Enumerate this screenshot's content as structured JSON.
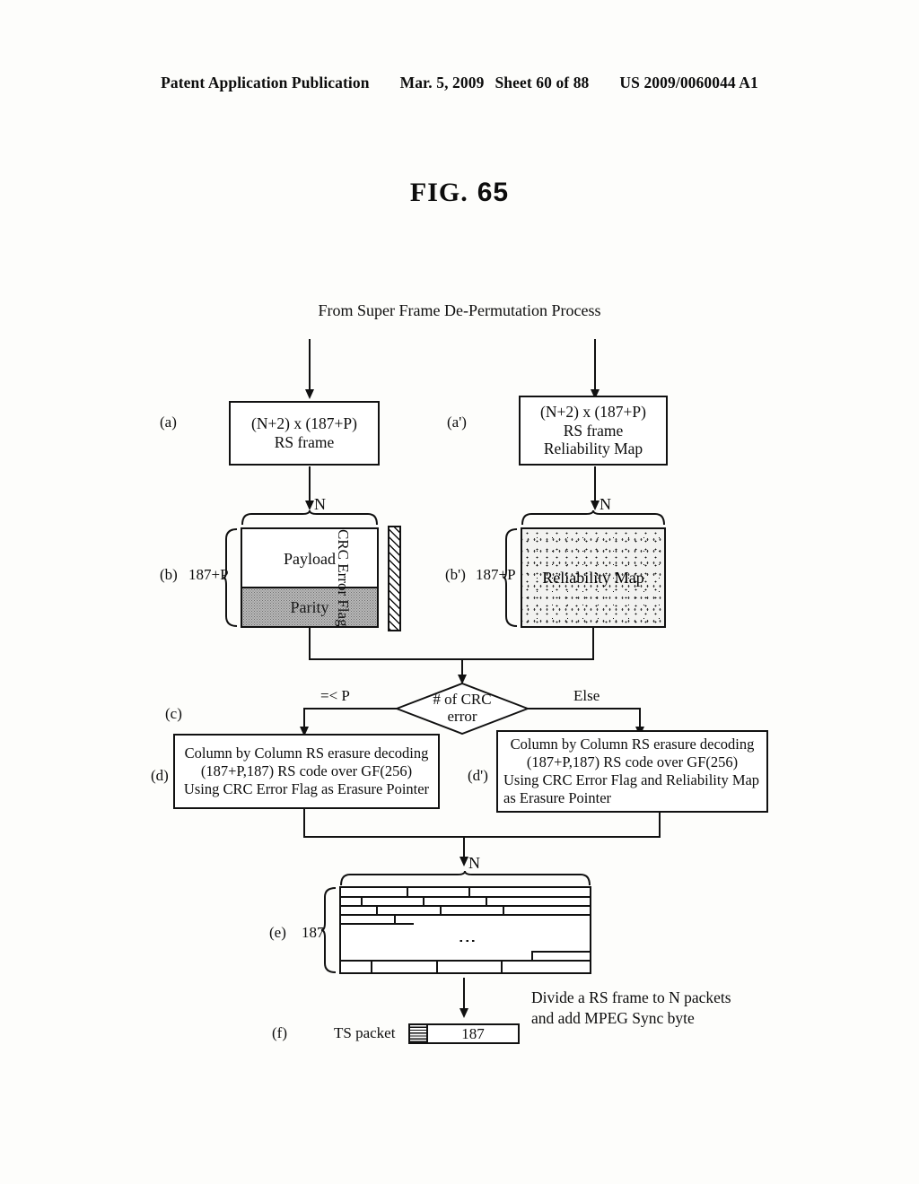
{
  "header": {
    "publication": "Patent Application Publication",
    "date": "Mar. 5, 2009",
    "sheet": "Sheet 60 of 88",
    "docnum": "US 2009/0060044 A1"
  },
  "figure": {
    "label": "FIG.",
    "number": "65"
  },
  "diagram": {
    "source_text": "From Super Frame De-Permutation Process",
    "steps": {
      "a": {
        "tag": "(a)",
        "line1": "(N+2) x (187+P)",
        "line2": "RS frame"
      },
      "a_prime": {
        "tag": "(a')",
        "line1": "(N+2) x (187+P)",
        "line2": "RS frame",
        "line3": "Reliability Map"
      },
      "b": {
        "tag": "(b)",
        "row_label": "187+P",
        "top_label": "N",
        "payload": "Payload",
        "parity": "Parity",
        "crc_flag": "CRC Error Flag"
      },
      "b_prime": {
        "tag": "(b')",
        "row_label": "187+P",
        "top_label": "N",
        "map": "Reliability Map"
      },
      "c": {
        "tag": "(c)",
        "decision_line1": "# of CRC",
        "decision_line2": "error",
        "branch_left": "=< P",
        "branch_right": "Else"
      },
      "d": {
        "tag": "(d)",
        "line1": "Column by Column RS erasure decoding",
        "line2": "(187+P,187) RS code over GF(256)",
        "line3": "Using CRC Error Flag as Erasure Pointer"
      },
      "d_prime": {
        "tag": "(d')",
        "line1": "Column by Column RS erasure decoding",
        "line2": "(187+P,187) RS code over GF(256)",
        "line3": "Using CRC Error Flag and Reliability Map",
        "line4": "as Erasure Pointer"
      },
      "e": {
        "tag": "(e)",
        "row_label": "187",
        "top_label": "N",
        "vertical_dots": "⋮"
      },
      "f": {
        "tag": "(f)",
        "packet_label": "TS packet",
        "body_label": "187",
        "note_line1": "Divide a RS frame to N packets",
        "note_line2": "and add MPEG Sync byte"
      }
    }
  }
}
